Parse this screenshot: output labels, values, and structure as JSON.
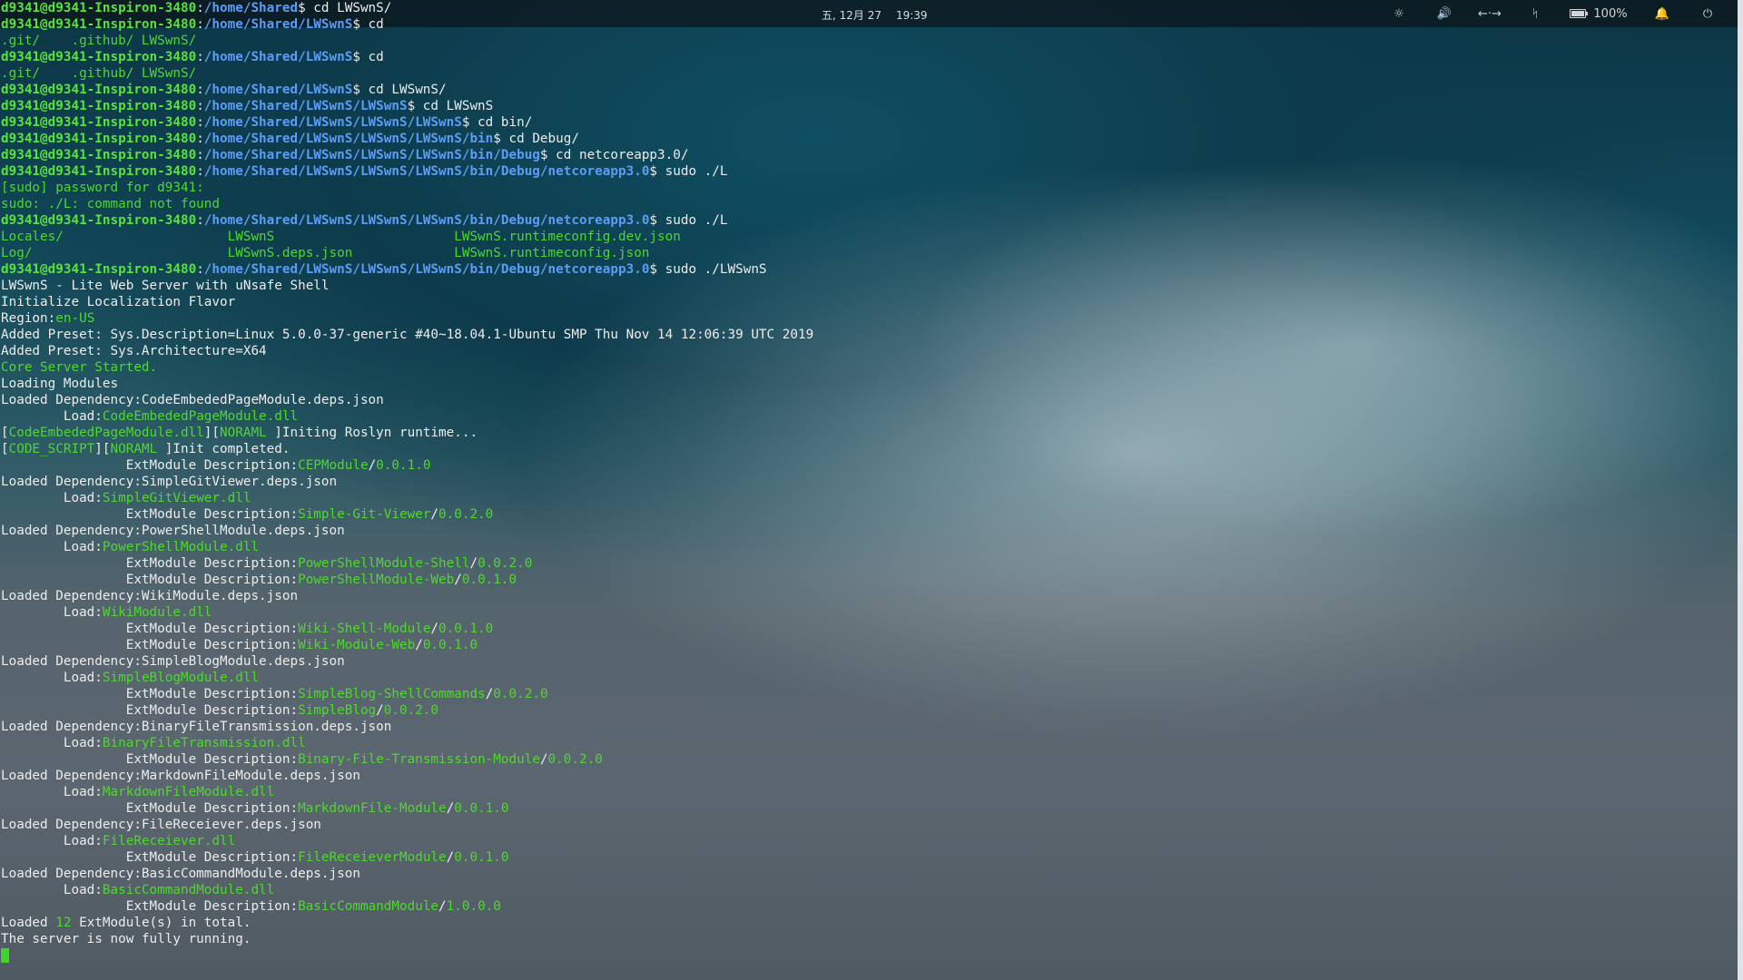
{
  "colors": {
    "prompt_user": "#57e33a",
    "prompt_path": "#5b9df6",
    "green_text": "#4ed82e",
    "text": "#ececec"
  },
  "topbar": {
    "date": "五, 12月 27",
    "time": "19:39",
    "icons": [
      "brightness-icon",
      "volume-icon",
      "network-icon",
      "bluetooth-icon",
      "battery-icon",
      "notification-bell-icon",
      "power-icon"
    ],
    "battery_label": "100%",
    "battery_level": 1.0
  },
  "terminal": {
    "lines": [
      [
        {
          "t": "d9341@d9341-Inspiron-3480",
          "c": "gb"
        },
        {
          "t": ":",
          "c": "w"
        },
        {
          "t": "/home/Shared",
          "c": "b"
        },
        {
          "t": "$ cd LWSwnS/",
          "c": "w"
        }
      ],
      [
        {
          "t": "d9341@d9341-Inspiron-3480",
          "c": "gb"
        },
        {
          "t": ":",
          "c": "w"
        },
        {
          "t": "/home/Shared/LWSwnS",
          "c": "b"
        },
        {
          "t": "$ cd",
          "c": "w"
        }
      ],
      [
        {
          "t": ".git/    .github/ LWSwnS/",
          "c": "g"
        }
      ],
      [
        {
          "t": "d9341@d9341-Inspiron-3480",
          "c": "gb"
        },
        {
          "t": ":",
          "c": "w"
        },
        {
          "t": "/home/Shared/LWSwnS",
          "c": "b"
        },
        {
          "t": "$ cd",
          "c": "w"
        }
      ],
      [
        {
          "t": ".git/    .github/ LWSwnS/",
          "c": "g"
        }
      ],
      [
        {
          "t": "d9341@d9341-Inspiron-3480",
          "c": "gb"
        },
        {
          "t": ":",
          "c": "w"
        },
        {
          "t": "/home/Shared/LWSwnS",
          "c": "b"
        },
        {
          "t": "$ cd LWSwnS/",
          "c": "w"
        }
      ],
      [
        {
          "t": "d9341@d9341-Inspiron-3480",
          "c": "gb"
        },
        {
          "t": ":",
          "c": "w"
        },
        {
          "t": "/home/Shared/LWSwnS/LWSwnS",
          "c": "b"
        },
        {
          "t": "$ cd LWSwnS",
          "c": "w"
        }
      ],
      [
        {
          "t": "d9341@d9341-Inspiron-3480",
          "c": "gb"
        },
        {
          "t": ":",
          "c": "w"
        },
        {
          "t": "/home/Shared/LWSwnS/LWSwnS/LWSwnS",
          "c": "b"
        },
        {
          "t": "$ cd bin/",
          "c": "w"
        }
      ],
      [
        {
          "t": "d9341@d9341-Inspiron-3480",
          "c": "gb"
        },
        {
          "t": ":",
          "c": "w"
        },
        {
          "t": "/home/Shared/LWSwnS/LWSwnS/LWSwnS/bin",
          "c": "b"
        },
        {
          "t": "$ cd Debug/",
          "c": "w"
        }
      ],
      [
        {
          "t": "d9341@d9341-Inspiron-3480",
          "c": "gb"
        },
        {
          "t": ":",
          "c": "w"
        },
        {
          "t": "/home/Shared/LWSwnS/LWSwnS/LWSwnS/bin/Debug",
          "c": "b"
        },
        {
          "t": "$ cd netcoreapp3.0/",
          "c": "w"
        }
      ],
      [
        {
          "t": "d9341@d9341-Inspiron-3480",
          "c": "gb"
        },
        {
          "t": ":",
          "c": "w"
        },
        {
          "t": "/home/Shared/LWSwnS/LWSwnS/LWSwnS/bin/Debug/netcoreapp3.0",
          "c": "b"
        },
        {
          "t": "$ sudo ./L",
          "c": "w"
        }
      ],
      [
        {
          "t": "[sudo] password for d9341:",
          "c": "g"
        }
      ],
      [
        {
          "t": "sudo: ./L: command not found",
          "c": "g"
        }
      ],
      [
        {
          "t": "d9341@d9341-Inspiron-3480",
          "c": "gb"
        },
        {
          "t": ":",
          "c": "w"
        },
        {
          "t": "/home/Shared/LWSwnS/LWSwnS/LWSwnS/bin/Debug/netcoreapp3.0",
          "c": "b"
        },
        {
          "t": "$ sudo ./L",
          "c": "w"
        }
      ],
      [
        {
          "t": "Locales/                     LWSwnS                       LWSwnS.runtimeconfig.dev.json",
          "c": "g"
        }
      ],
      [
        {
          "t": "Log/                         LWSwnS.deps.json             LWSwnS.runtimeconfig.json",
          "c": "g"
        }
      ],
      [
        {
          "t": "d9341@d9341-Inspiron-3480",
          "c": "gb"
        },
        {
          "t": ":",
          "c": "w"
        },
        {
          "t": "/home/Shared/LWSwnS/LWSwnS/LWSwnS/bin/Debug/netcoreapp3.0",
          "c": "b"
        },
        {
          "t": "$ sudo ./LWSwnS",
          "c": "w"
        }
      ],
      [
        {
          "t": "LWSwnS - Lite Web Server with uNsafe Shell",
          "c": "w"
        }
      ],
      [
        {
          "t": "Initialize Localization Flavor",
          "c": "w"
        }
      ],
      [
        {
          "t": "Region:",
          "c": "w"
        },
        {
          "t": "en-US",
          "c": "g"
        }
      ],
      [
        {
          "t": "Added Preset: Sys.Description=Linux 5.0.0-37-generic #40~18.04.1-Ubuntu SMP Thu Nov 14 12:06:39 UTC 2019",
          "c": "w"
        }
      ],
      [
        {
          "t": "Added Preset: Sys.Architecture=X64",
          "c": "w"
        }
      ],
      [
        {
          "t": "Core Server Started.",
          "c": "g"
        }
      ],
      [
        {
          "t": "Loading Modules",
          "c": "w"
        }
      ],
      [
        {
          "t": "Loaded Dependency:CodeEmbededPageModule.deps.json",
          "c": "w"
        }
      ],
      [
        {
          "t": "        Load:",
          "c": "w"
        },
        {
          "t": "CodeEmbededPageModule.dll",
          "c": "g"
        }
      ],
      [
        {
          "t": "[",
          "c": "w"
        },
        {
          "t": "CodeEmbededPageModule.dll",
          "c": "g"
        },
        {
          "t": "][",
          "c": "w"
        },
        {
          "t": "NORAML ",
          "c": "g"
        },
        {
          "t": "]Initing Roslyn runtime...",
          "c": "w"
        }
      ],
      [
        {
          "t": "[",
          "c": "w"
        },
        {
          "t": "CODE_SCRIPT",
          "c": "g"
        },
        {
          "t": "][",
          "c": "w"
        },
        {
          "t": "NORAML ",
          "c": "g"
        },
        {
          "t": "]Init completed.",
          "c": "w"
        }
      ],
      [
        {
          "t": "                ExtModule Description:",
          "c": "w"
        },
        {
          "t": "CEPModule",
          "c": "g"
        },
        {
          "t": "/",
          "c": "w"
        },
        {
          "t": "0.0.1.0",
          "c": "g"
        }
      ],
      [
        {
          "t": "Loaded Dependency:SimpleGitViewer.deps.json",
          "c": "w"
        }
      ],
      [
        {
          "t": "        Load:",
          "c": "w"
        },
        {
          "t": "SimpleGitViewer.dll",
          "c": "g"
        }
      ],
      [
        {
          "t": "                ExtModule Description:",
          "c": "w"
        },
        {
          "t": "Simple-Git-Viewer",
          "c": "g"
        },
        {
          "t": "/",
          "c": "w"
        },
        {
          "t": "0.0.2.0",
          "c": "g"
        }
      ],
      [
        {
          "t": "Loaded Dependency:PowerShellModule.deps.json",
          "c": "w"
        }
      ],
      [
        {
          "t": "        Load:",
          "c": "w"
        },
        {
          "t": "PowerShellModule.dll",
          "c": "g"
        }
      ],
      [
        {
          "t": "                ExtModule Description:",
          "c": "w"
        },
        {
          "t": "PowerShellModule-Shell",
          "c": "g"
        },
        {
          "t": "/",
          "c": "w"
        },
        {
          "t": "0.0.2.0",
          "c": "g"
        }
      ],
      [
        {
          "t": "                ExtModule Description:",
          "c": "w"
        },
        {
          "t": "PowerShellModule-Web",
          "c": "g"
        },
        {
          "t": "/",
          "c": "w"
        },
        {
          "t": "0.0.1.0",
          "c": "g"
        }
      ],
      [
        {
          "t": "Loaded Dependency:WikiModule.deps.json",
          "c": "w"
        }
      ],
      [
        {
          "t": "        Load:",
          "c": "w"
        },
        {
          "t": "WikiModule.dll",
          "c": "g"
        }
      ],
      [
        {
          "t": "                ExtModule Description:",
          "c": "w"
        },
        {
          "t": "Wiki-Shell-Module",
          "c": "g"
        },
        {
          "t": "/",
          "c": "w"
        },
        {
          "t": "0.0.1.0",
          "c": "g"
        }
      ],
      [
        {
          "t": "                ExtModule Description:",
          "c": "w"
        },
        {
          "t": "Wiki-Module-Web",
          "c": "g"
        },
        {
          "t": "/",
          "c": "w"
        },
        {
          "t": "0.0.1.0",
          "c": "g"
        }
      ],
      [
        {
          "t": "Loaded Dependency:SimpleBlogModule.deps.json",
          "c": "w"
        }
      ],
      [
        {
          "t": "        Load:",
          "c": "w"
        },
        {
          "t": "SimpleBlogModule.dll",
          "c": "g"
        }
      ],
      [
        {
          "t": "                ExtModule Description:",
          "c": "w"
        },
        {
          "t": "SimpleBlog-ShellCommands",
          "c": "g"
        },
        {
          "t": "/",
          "c": "w"
        },
        {
          "t": "0.0.2.0",
          "c": "g"
        }
      ],
      [
        {
          "t": "                ExtModule Description:",
          "c": "w"
        },
        {
          "t": "SimpleBlog",
          "c": "g"
        },
        {
          "t": "/",
          "c": "w"
        },
        {
          "t": "0.0.2.0",
          "c": "g"
        }
      ],
      [
        {
          "t": "Loaded Dependency:BinaryFileTransmission.deps.json",
          "c": "w"
        }
      ],
      [
        {
          "t": "        Load:",
          "c": "w"
        },
        {
          "t": "BinaryFileTransmission.dll",
          "c": "g"
        }
      ],
      [
        {
          "t": "                ExtModule Description:",
          "c": "w"
        },
        {
          "t": "Binary-File-Transmission-Module",
          "c": "g"
        },
        {
          "t": "/",
          "c": "w"
        },
        {
          "t": "0.0.2.0",
          "c": "g"
        }
      ],
      [
        {
          "t": "Loaded Dependency:MarkdownFileModule.deps.json",
          "c": "w"
        }
      ],
      [
        {
          "t": "        Load:",
          "c": "w"
        },
        {
          "t": "MarkdownFileModule.dll",
          "c": "g"
        }
      ],
      [
        {
          "t": "                ExtModule Description:",
          "c": "w"
        },
        {
          "t": "MarkdownFile-Module",
          "c": "g"
        },
        {
          "t": "/",
          "c": "w"
        },
        {
          "t": "0.0.1.0",
          "c": "g"
        }
      ],
      [
        {
          "t": "Loaded Dependency:FileReceiever.deps.json",
          "c": "w"
        }
      ],
      [
        {
          "t": "        Load:",
          "c": "w"
        },
        {
          "t": "FileReceiever.dll",
          "c": "g"
        }
      ],
      [
        {
          "t": "                ExtModule Description:",
          "c": "w"
        },
        {
          "t": "FileReceieverModule",
          "c": "g"
        },
        {
          "t": "/",
          "c": "w"
        },
        {
          "t": "0.0.1.0",
          "c": "g"
        }
      ],
      [
        {
          "t": "Loaded Dependency:BasicCommandModule.deps.json",
          "c": "w"
        }
      ],
      [
        {
          "t": "        Load:",
          "c": "w"
        },
        {
          "t": "BasicCommandModule.dll",
          "c": "g"
        }
      ],
      [
        {
          "t": "                ExtModule Description:",
          "c": "w"
        },
        {
          "t": "BasicCommandModule",
          "c": "g"
        },
        {
          "t": "/",
          "c": "w"
        },
        {
          "t": "1.0.0.0",
          "c": "g"
        }
      ],
      [
        {
          "t": "Loaded ",
          "c": "w"
        },
        {
          "t": "12",
          "c": "g"
        },
        {
          "t": " ExtModule(s) in total.",
          "c": "w"
        }
      ],
      [
        {
          "t": "The server is now fully running.",
          "c": "w"
        }
      ]
    ]
  }
}
